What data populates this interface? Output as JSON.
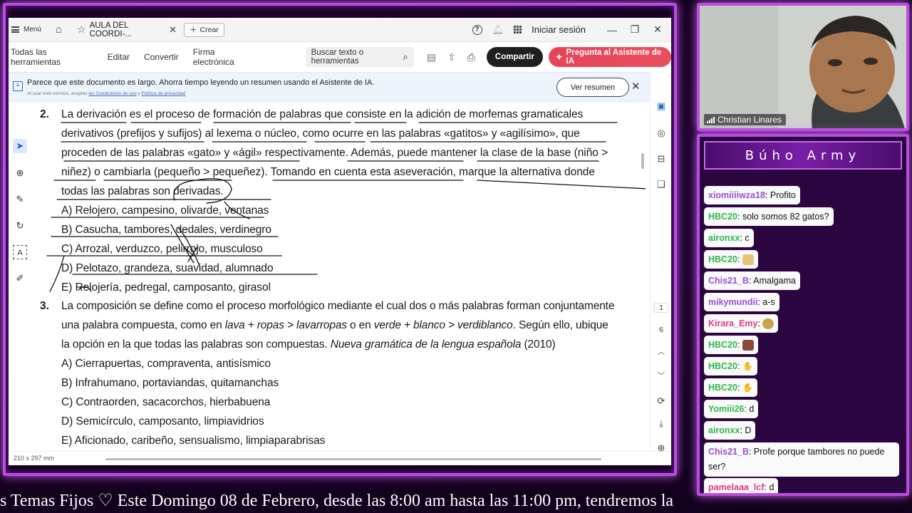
{
  "app": {
    "menu_label": "Menú",
    "tab_title": "AULA DEL COORDI-...",
    "create_label": "Crear",
    "signin_label": "Iniciar sesión"
  },
  "toolbar": {
    "items": [
      "Todas las herramientas",
      "Editar",
      "Convertir",
      "Firma electrónica"
    ],
    "search_placeholder": "Buscar texto o herramientas",
    "share_label": "Compartir",
    "ai_label": "Pregunta al Asistente de IA"
  },
  "banner": {
    "message": "Parece que este documento es largo. Ahorra tiempo leyendo un resumen usando el Asistente de IA.",
    "subtext_prefix": "Al usar este servicio, aceptas",
    "terms_link": "las Condiciones de uso",
    "subtext_join": "y",
    "privacy_link": "Política de privacidad",
    "summary_button": "Ver resumen"
  },
  "pager": {
    "current_page": "1",
    "total_pages": "6"
  },
  "status": {
    "page_size": "210 x 297 mm"
  },
  "document": {
    "q2_number": "2.",
    "q2_lines": [
      "La derivación es el proceso de formación de palabras que consiste en la adición de morfemas gramaticales",
      "derivativos (prefijos y sufijos) al lexema o núcleo, como ocurre en las palabras «gatitos» y «agilísimo», que",
      "proceden de las palabras «gato» y «ágil» respectivamente. Además, puede mantener la clase de la base (niño >",
      "niñez) o cambiarla (pequeño > pequeñez). Tomando en cuenta esta aseveración, marque la alternativa donde",
      "todas las palabras son derivadas."
    ],
    "q2_options": [
      "A) Relojero, campesino, olivarde, ventanas",
      "B) Casucha, tambores, dedales, verdinegro",
      "C) Arrozal, verduzco, pelirrojo, musculoso",
      "D) Pelotazo, grandeza, suavidad, alumnado",
      "E) Relojería, pedregal, camposanto, girasol"
    ],
    "q3_number": "3.",
    "q3_line1": "La composición se define como el proceso morfológico mediante el cual dos o más palabras forman conjuntamente",
    "q3_line2_a": "una palabra compuesta, como en ",
    "q3_line2_i1": "lava + ropas > lavarropas",
    "q3_line2_b": " o en ",
    "q3_line2_i2": "verde + blanco > verdiblanco",
    "q3_line2_c": ". Según ello, ubique",
    "q3_line3_a": "la opción en la que todas las palabras son compuestas. ",
    "q3_line3_i": "Nueva gramática de la lengua española",
    "q3_line3_b": " (2010)",
    "q3_options": [
      "A) Cierrapuertas, compraventa, antisísmico",
      "B) Infrahumano, portaviandas, quitamanchas",
      "C) Contraorden, sacacorchos, hierbabuena",
      "D) Semicírculo, camposanto, limpiavidrios",
      "E) Aficionado, caribeño, sensualismo, limpiaparabrisas"
    ]
  },
  "webcam": {
    "name": "Christian Linares"
  },
  "chat": {
    "title": "Búho Army",
    "messages": [
      {
        "user": "xiomiiiiwza18",
        "text": ": Profito",
        "color": "#9a4fd8"
      },
      {
        "user": "HBC20",
        "text": ": solo somos 82 gatos?",
        "color": "#2fb84a"
      },
      {
        "user": "aironxx",
        "text": ": c",
        "color": "#2fb84a"
      },
      {
        "user": "HBC20",
        "text": ": ",
        "emoji": "cat-emoji",
        "color": "#2fb84a"
      },
      {
        "user": "Chis21_B",
        "text": ": Amalgama",
        "color": "#9a4fd8"
      },
      {
        "user": "mikymundii",
        "text": ": a-s",
        "color": "#9a4fd8"
      },
      {
        "user": "Kirara_Emy",
        "text": ": ",
        "emoji": "money-bag-emoji",
        "color": "#e03a8a"
      },
      {
        "user": "HBC20",
        "text": ": ",
        "emoji": "person-emoji",
        "color": "#2fb84a"
      },
      {
        "user": "HBC20",
        "text": ": ",
        "emoji": "wave-emoji",
        "color": "#2fb84a"
      },
      {
        "user": "HBC20",
        "text": ": ",
        "emoji": "wave-emoji",
        "color": "#2fb84a"
      },
      {
        "user": "Yomiii26",
        "text": ": d",
        "color": "#2fb84a"
      },
      {
        "user": "aironxx",
        "text": ": D",
        "color": "#2fb84a"
      },
      {
        "user": "Chis21_B",
        "text": ": Profe porque tambores no puede ser?",
        "color": "#9a4fd8"
      },
      {
        "user": "pamelaaa_lcf",
        "text": ": d",
        "color": "#e03a8a"
      }
    ]
  },
  "ticker": {
    "text": "s Temas Fijos ♡  Este Domingo 08 de Febrero, desde las 8:00 am hasta las 11:00 pm, tendremos la"
  },
  "colors": {
    "frame": "#b84de0",
    "accent_ai": "#e8445a",
    "ink": "#111111"
  }
}
